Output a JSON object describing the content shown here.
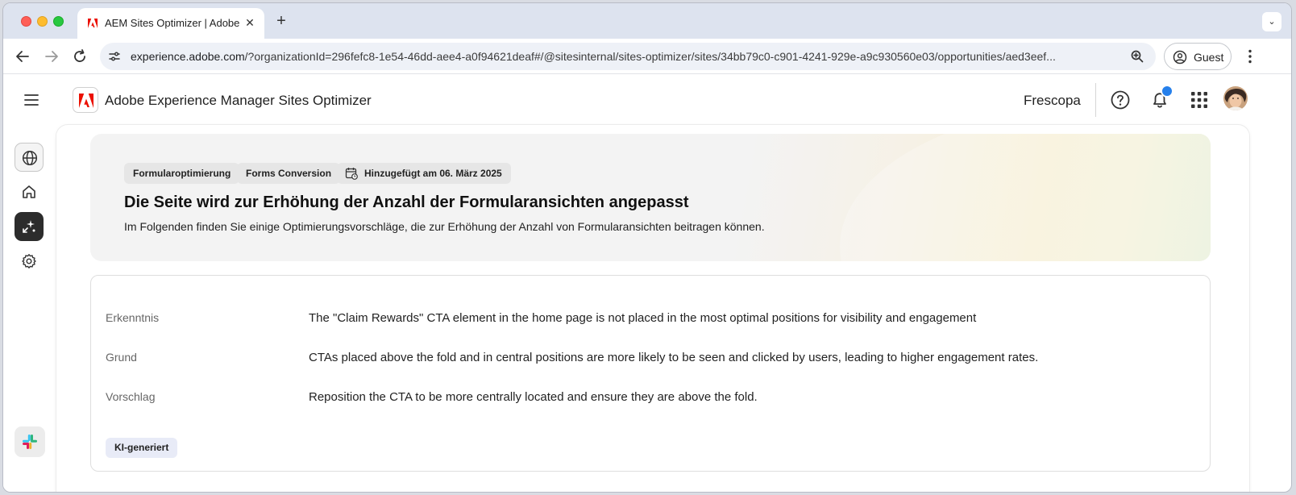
{
  "browser": {
    "tab_title": "AEM Sites Optimizer | Adobe",
    "tab_close_glyph": "✕",
    "new_tab_glyph": "+",
    "tab_menu_glyph": "⌄",
    "url_host": "experience.adobe.com",
    "url_path": "/?organizationId=296fefc8-1e54-46dd-aee4-a0f94621deaf#/@sitesinternal/sites-optimizer/sites/34bb79c0-c901-4241-929e-a9c930560e03/opportunities/aed3eef...",
    "profile_label": "Guest"
  },
  "app": {
    "title": "Adobe Experience Manager Sites Optimizer",
    "org_name": "Frescopa",
    "brand_color": "#eb1000",
    "notification_color": "#2680eb"
  },
  "hero": {
    "chips": [
      "Formularoptimierung",
      "Forms Conversion",
      "Hinzugefügt am 06. März 2025"
    ],
    "title": "Die Seite wird zur Erhöhung der Anzahl der Formularansichten angepasst",
    "subtitle": "Im Folgenden finden Sie einige Optimierungsvorschläge, die zur Erhöhung der Anzahl von Formularansichten beitragen können."
  },
  "details": {
    "rows": [
      {
        "label": "Erkenntnis",
        "value": "The \"Claim Rewards\" CTA element in the home page is not placed in the most optimal positions for visibility and engagement"
      },
      {
        "label": "Grund",
        "value": "CTAs placed above the fold and in central positions are more likely to be seen and clicked by users, leading to higher engagement rates."
      },
      {
        "label": "Vorschlag",
        "value": "Reposition the CTA to be more centrally located and ensure they are above the fold."
      }
    ],
    "badge": "KI-generiert"
  },
  "icons": {
    "rail": [
      "globe-icon",
      "home-icon",
      "optimizer-icon",
      "settings-icon",
      "slack-icon"
    ],
    "header": [
      "menu-icon",
      "help-icon",
      "bell-icon",
      "apps-grid-icon"
    ]
  }
}
